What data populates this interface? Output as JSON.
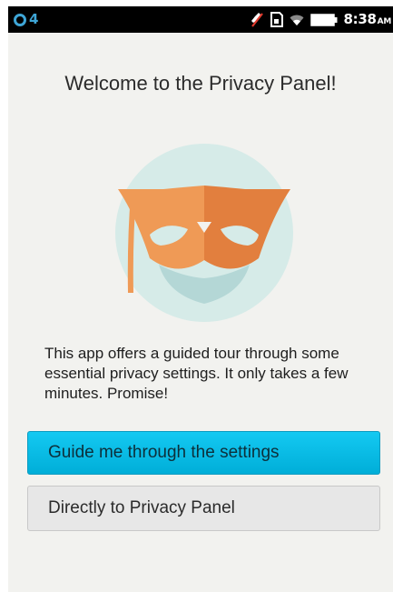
{
  "status_bar": {
    "notification_count": "4",
    "time": "8:38",
    "ampm": "AM",
    "icons": [
      "notification-icon",
      "mute-icon",
      "sim-icon",
      "wifi-icon",
      "battery-icon"
    ]
  },
  "welcome": {
    "title": "Welcome to the Privacy Panel!",
    "hero_icon": "mask-icon",
    "description": "This app offers a guided tour through some essential privacy settings. It only takes a few minutes. Promise!"
  },
  "actions": {
    "guide_label": "Guide me through the settings",
    "direct_label": "Directly to Privacy Panel"
  },
  "colors": {
    "accent": "#00b8e6",
    "mask": "#e98a4c",
    "circle": "#d6ebe8"
  }
}
